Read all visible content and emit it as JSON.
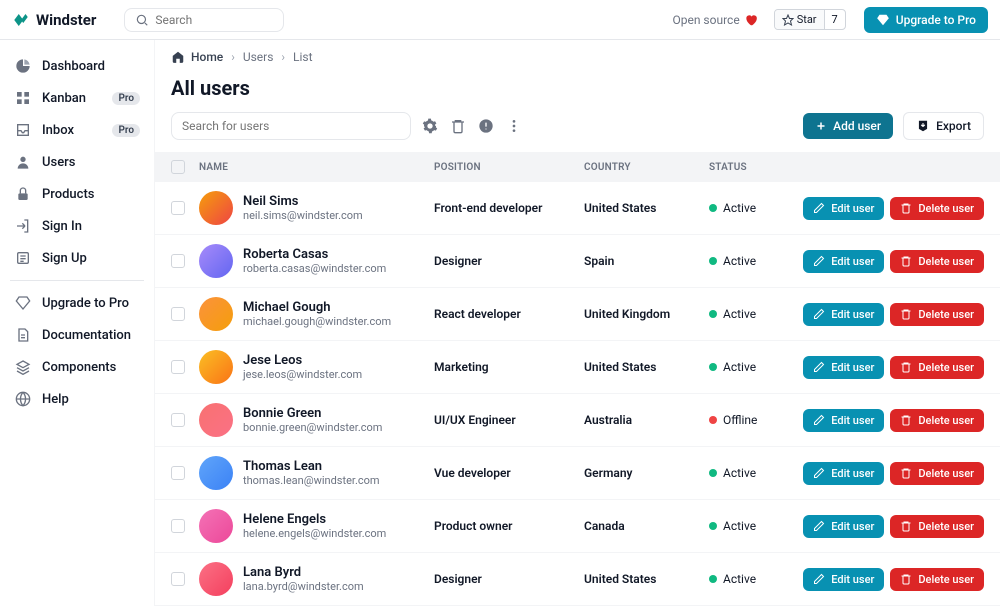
{
  "brand": "Windster",
  "top_search_placeholder": "Search",
  "open_source_label": "Open source",
  "star_label": "Star",
  "star_count": "7",
  "upgrade_label": "Upgrade to Pro",
  "sidebar": {
    "items": [
      {
        "icon": "pie",
        "label": "Dashboard",
        "badge": ""
      },
      {
        "icon": "grid",
        "label": "Kanban",
        "badge": "Pro"
      },
      {
        "icon": "inbox",
        "label": "Inbox",
        "badge": "Pro"
      },
      {
        "icon": "user",
        "label": "Users",
        "badge": ""
      },
      {
        "icon": "lock",
        "label": "Products",
        "badge": ""
      },
      {
        "icon": "login",
        "label": "Sign In",
        "badge": ""
      },
      {
        "icon": "form",
        "label": "Sign Up",
        "badge": ""
      }
    ],
    "items2": [
      {
        "icon": "gem",
        "label": "Upgrade to Pro"
      },
      {
        "icon": "doc",
        "label": "Documentation"
      },
      {
        "icon": "layers",
        "label": "Components"
      },
      {
        "icon": "globe",
        "label": "Help"
      }
    ]
  },
  "breadcrumb": {
    "home": "Home",
    "mid": "Users",
    "last": "List"
  },
  "page_title": "All users",
  "user_search_placeholder": "Search for users",
  "add_user_label": "Add user",
  "export_label": "Export",
  "table": {
    "headers": {
      "name": "Name",
      "position": "Position",
      "country": "Country",
      "status": "Status"
    },
    "edit_label": "Edit user",
    "delete_label": "Delete user",
    "rows": [
      {
        "name": "Neil Sims",
        "email": "neil.sims@windster.com",
        "position": "Front-end developer",
        "country": "United States",
        "status": "Active"
      },
      {
        "name": "Roberta Casas",
        "email": "roberta.casas@windster.com",
        "position": "Designer",
        "country": "Spain",
        "status": "Active"
      },
      {
        "name": "Michael Gough",
        "email": "michael.gough@windster.com",
        "position": "React developer",
        "country": "United Kingdom",
        "status": "Active"
      },
      {
        "name": "Jese Leos",
        "email": "jese.leos@windster.com",
        "position": "Marketing",
        "country": "United States",
        "status": "Active"
      },
      {
        "name": "Bonnie Green",
        "email": "bonnie.green@windster.com",
        "position": "UI/UX Engineer",
        "country": "Australia",
        "status": "Offline"
      },
      {
        "name": "Thomas Lean",
        "email": "thomas.lean@windster.com",
        "position": "Vue developer",
        "country": "Germany",
        "status": "Active"
      },
      {
        "name": "Helene Engels",
        "email": "helene.engels@windster.com",
        "position": "Product owner",
        "country": "Canada",
        "status": "Active"
      },
      {
        "name": "Lana Byrd",
        "email": "lana.byrd@windster.com",
        "position": "Designer",
        "country": "United States",
        "status": "Active"
      }
    ]
  }
}
